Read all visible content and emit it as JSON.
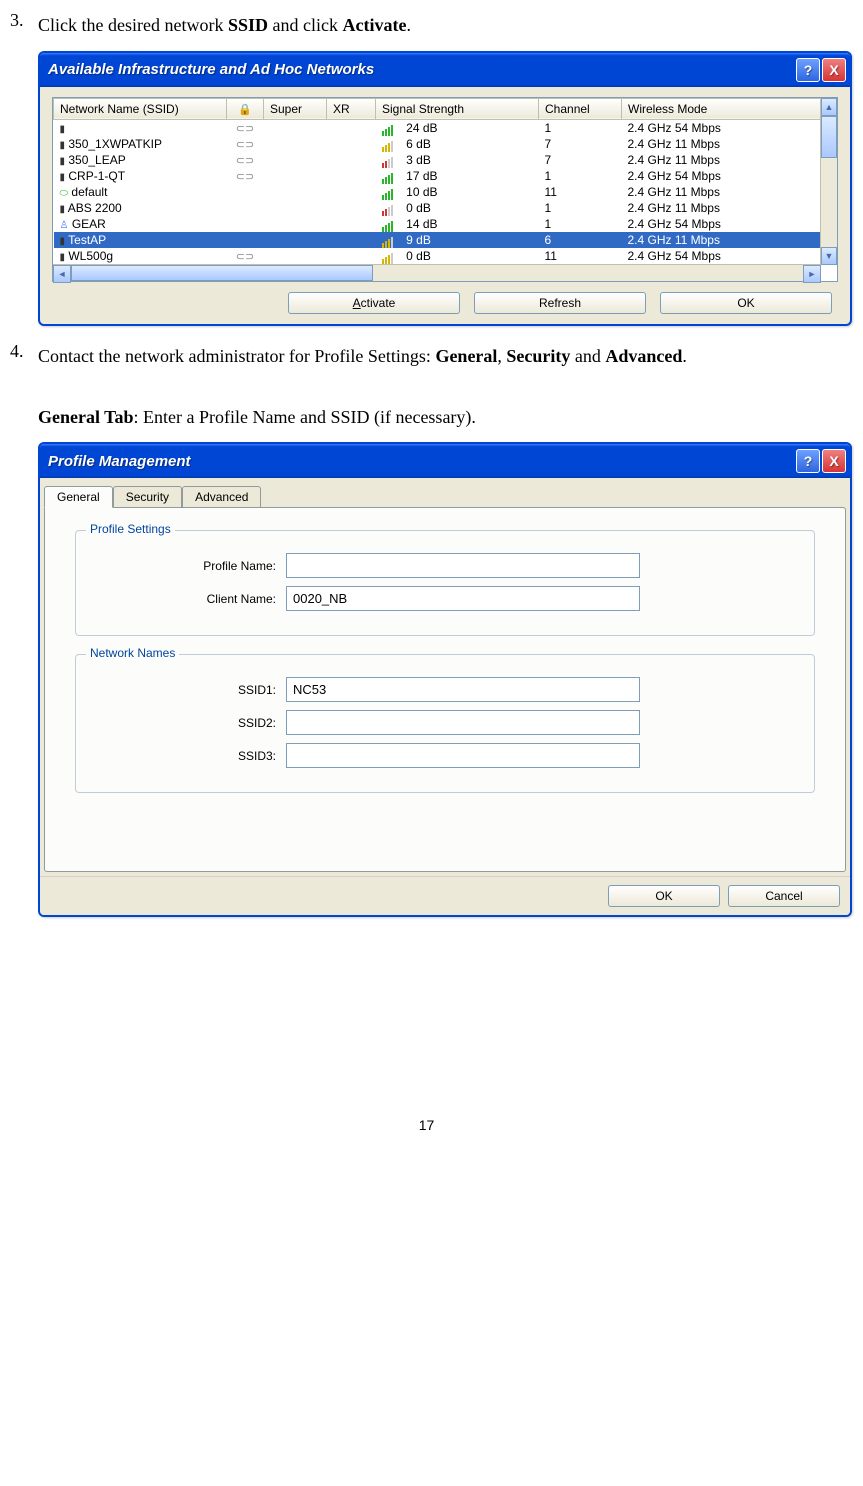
{
  "step3": {
    "num": "3.",
    "text_a": "Click the desired network ",
    "bold_a": "SSID",
    "text_b": " and click ",
    "bold_b": "Activate",
    "text_c": "."
  },
  "dialog1": {
    "title": "Available Infrastructure and Ad Hoc Networks",
    "help": "?",
    "close": "X",
    "headers": {
      "ssid": "Network Name (SSID)",
      "sec": "",
      "super": "Super",
      "xr": "XR",
      "signal": "Signal Strength",
      "channel": "Channel",
      "mode": "Wireless Mode"
    },
    "rows": [
      {
        "icon": "i",
        "name": "",
        "sec": "🔑",
        "sig": "g4",
        "db": "24 dB",
        "ch": "1",
        "mode": "2.4 GHz 54 Mbps"
      },
      {
        "icon": "i",
        "name": "350_1XWPATKIP",
        "sec": "🔑",
        "sig": "y3",
        "db": "6 dB",
        "ch": "7",
        "mode": "2.4 GHz 11 Mbps"
      },
      {
        "icon": "i",
        "name": "350_LEAP",
        "sec": "🔑",
        "sig": "r2",
        "db": "3 dB",
        "ch": "7",
        "mode": "2.4 GHz 11 Mbps"
      },
      {
        "icon": "i",
        "name": "CRP-1-QT",
        "sec": "🔑",
        "sig": "g4",
        "db": "17 dB",
        "ch": "1",
        "mode": "2.4 GHz 54 Mbps"
      },
      {
        "icon": "a",
        "name": "default",
        "sec": "",
        "sig": "g4",
        "db": "10 dB",
        "ch": "11",
        "mode": "2.4 GHz 11 Mbps"
      },
      {
        "icon": "i",
        "name": "ABS 2200",
        "sec": "",
        "sig": "r2",
        "db": "0 dB",
        "ch": "1",
        "mode": "2.4 GHz 11 Mbps"
      },
      {
        "icon": "p",
        "name": "GEAR",
        "sec": "",
        "sig": "g4",
        "db": "14 dB",
        "ch": "1",
        "mode": "2.4 GHz 54 Mbps"
      },
      {
        "icon": "i",
        "name": "TestAP",
        "sec": "",
        "sig": "y3",
        "db": "9 dB",
        "ch": "6",
        "mode": "2.4 GHz 11 Mbps",
        "hl": true
      },
      {
        "icon": "i",
        "name": "WL500g",
        "sec": "🔑",
        "sig": "y3",
        "db": "0 dB",
        "ch": "11",
        "mode": "2.4 GHz 54 Mbps"
      }
    ],
    "activate_btn": "Activate",
    "refresh_btn": "Refresh",
    "ok_btn": "OK"
  },
  "step4": {
    "num": "4.",
    "text_a": "Contact the network administrator for Profile Settings: ",
    "bold_a": "General",
    "sep1": ", ",
    "bold_b": "Security",
    "sep2": " and ",
    "bold_c": "Advanced",
    "text_d": "."
  },
  "general_tab_text": {
    "bold": "General Tab",
    "rest": ": Enter a Profile Name and SSID (if necessary)."
  },
  "dialog2": {
    "title": "Profile Management",
    "help": "?",
    "close": "X",
    "tabs": {
      "general": "General",
      "security": "Security",
      "advanced": "Advanced"
    },
    "group1": {
      "title": "Profile Settings",
      "profile_name_label": "Profile Name:",
      "profile_name_value": "",
      "client_name_label": "Client Name:",
      "client_name_value": "0020_NB"
    },
    "group2": {
      "title": "Network Names",
      "ssid1_label": "SSID1:",
      "ssid1_value": "NC53",
      "ssid2_label": "SSID2:",
      "ssid2_value": "",
      "ssid3_label": "SSID3:",
      "ssid3_value": ""
    },
    "ok_btn": "OK",
    "cancel_btn": "Cancel"
  },
  "page_number": "17"
}
